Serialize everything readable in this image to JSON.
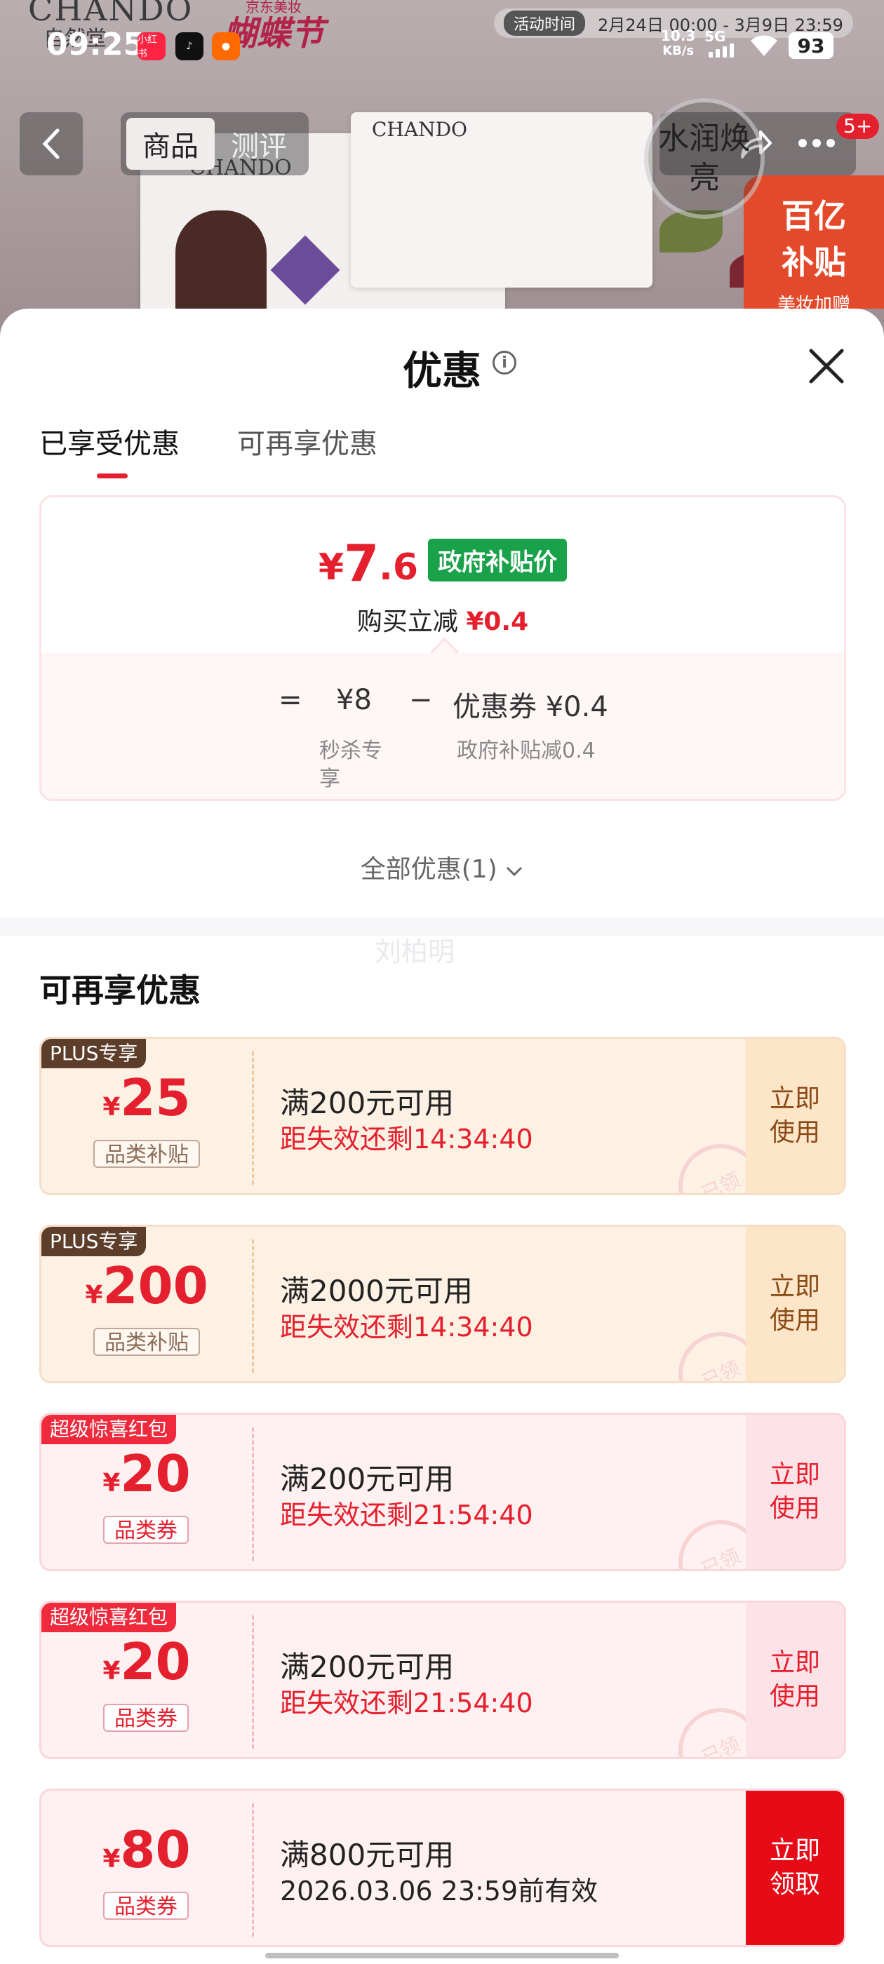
{
  "status_bar": {
    "time": "09:25",
    "net_speed": "10.3",
    "net_unit": "KB/s",
    "signal": "5G",
    "battery": "93",
    "apps": [
      "小红书",
      "抖音",
      "淘宝"
    ]
  },
  "background": {
    "brand": "CHANDO",
    "brand_cn": "自然堂",
    "festival": "蝴蝶节",
    "festival_small": "京东美妆",
    "activity_tag": "活动时间",
    "activity_time": "2月24日 00:00 - 3月9日 23:59",
    "circle_text": "水润焕亮",
    "badge": "5+",
    "ad_line1": "百亿",
    "ad_line2": "补贴",
    "ad_line3": "美妆加赠"
  },
  "nav": {
    "tab_product": "商品",
    "tab_review": "测评"
  },
  "sheet": {
    "title": "优惠",
    "tabs": [
      "已享受优惠",
      "可再享优惠"
    ],
    "summary": {
      "currency": "¥",
      "price_int": "7",
      "price_dec": ".6",
      "gov_tag": "政府补贴价",
      "reduce_label": "购买立减",
      "reduce_value": "¥0.4",
      "equals": "=",
      "base_price": "¥8",
      "minus": "−",
      "coupon_value": "优惠券 ¥0.4",
      "base_label": "秒杀专享",
      "coupon_label": "政府补贴减0.4"
    },
    "all_offers": "全部优惠(1)",
    "watermark": "刘柏明",
    "section_title": "可再享优惠"
  },
  "coupons": [
    {
      "label": "PLUS专享",
      "currency": "¥",
      "amount": "25",
      "tag": "品类补贴",
      "condition": "满200元可用",
      "expiry": "距失效还剩14:34:40",
      "action": "立即使用",
      "stamp": "已领"
    },
    {
      "label": "PLUS专享",
      "currency": "¥",
      "amount": "200",
      "tag": "品类补贴",
      "condition": "满2000元可用",
      "expiry": "距失效还剩14:34:40",
      "action": "立即使用",
      "stamp": "已领"
    },
    {
      "label": "超级惊喜红包",
      "currency": "¥",
      "amount": "20",
      "tag": "品类券",
      "condition": "满200元可用",
      "expiry": "距失效还剩21:54:40",
      "action": "立即使用",
      "stamp": "已领"
    },
    {
      "label": "超级惊喜红包",
      "currency": "¥",
      "amount": "20",
      "tag": "品类券",
      "condition": "满200元可用",
      "expiry": "距失效还剩21:54:40",
      "action": "立即使用",
      "stamp": "已领"
    },
    {
      "label": "",
      "currency": "¥",
      "amount": "80",
      "tag": "品类券",
      "condition": "满800元可用",
      "expiry": "2026.03.06 23:59前有效",
      "action": "立即领取",
      "stamp": ""
    }
  ],
  "colors": {
    "accent_red": "#e5202e",
    "gov_green": "#1aa24b",
    "plus_brown": "#5d3e2b"
  }
}
